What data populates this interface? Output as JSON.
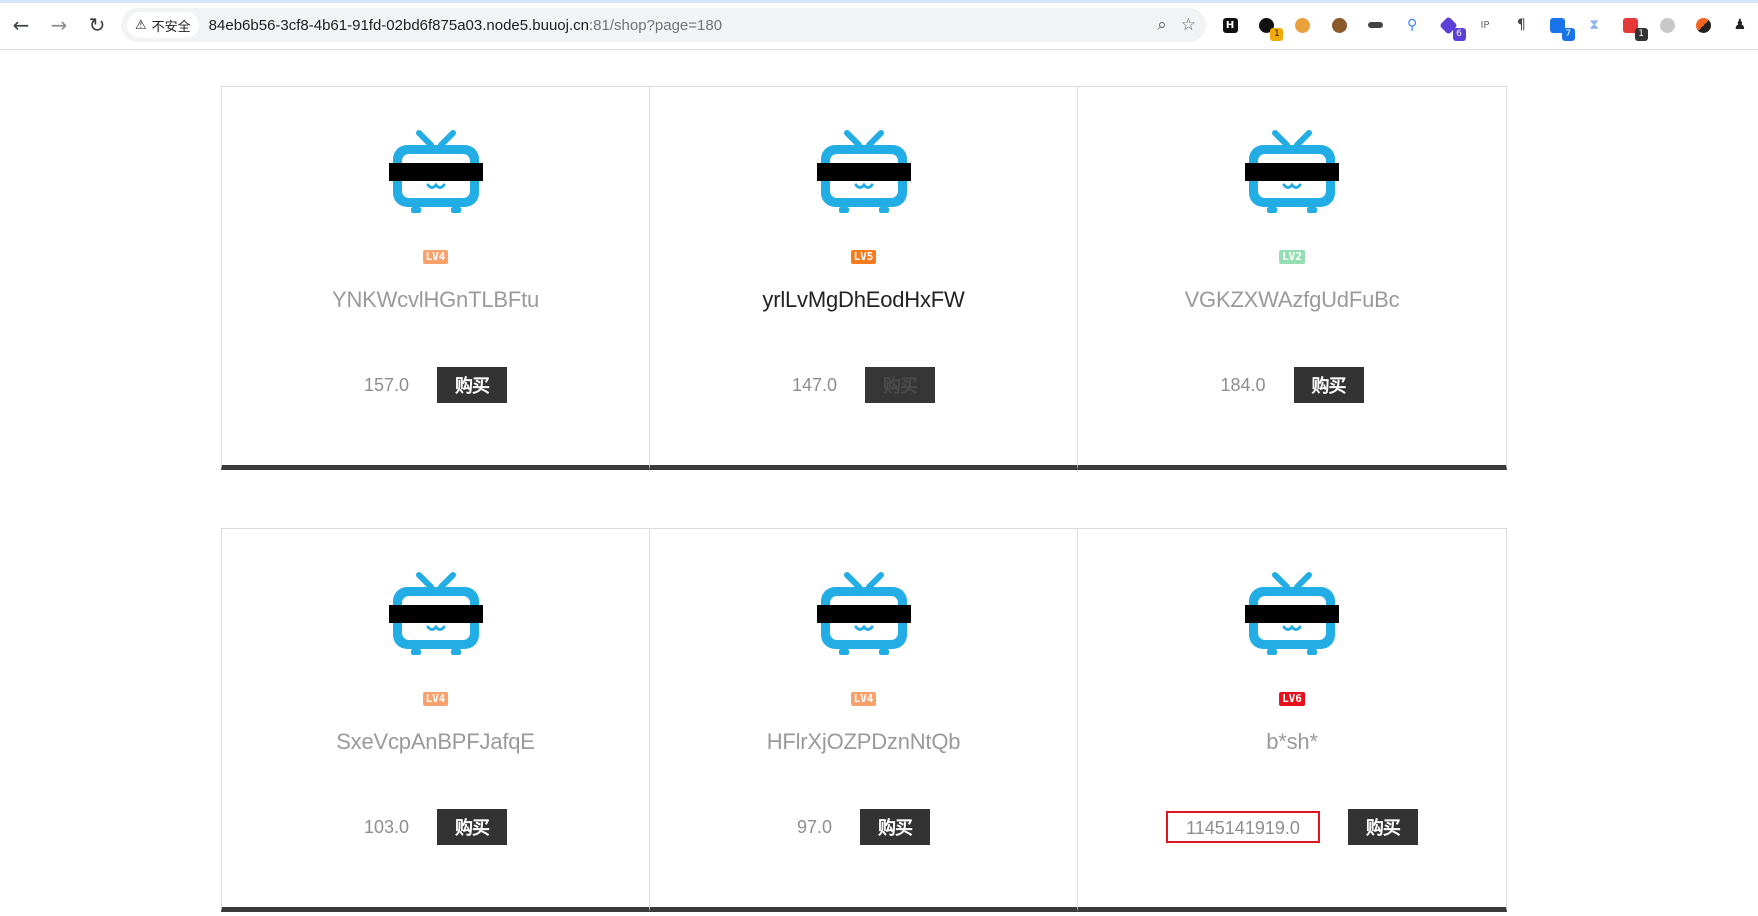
{
  "browser": {
    "security_label": "不安全",
    "url_host": "84eb6b56-3cf8-4b61-91fd-02bd6f875a03.node5.buuoj.cn",
    "url_rest": ":81/shop?page=180",
    "extension_badges": [
      "1",
      "6",
      "7",
      "1"
    ]
  },
  "products": [
    {
      "level": "LV4",
      "level_color": "#f9a16b",
      "name": "YNKWcvlHGnTLBFtu",
      "price": "157.0",
      "buy_label": "购买",
      "name_style": "muted",
      "button_enabled": true
    },
    {
      "level": "LV5",
      "level_color": "#f77a1d",
      "name": "yrlLvMgDhEodHxFW",
      "price": "147.0",
      "buy_label": "购买",
      "name_style": "dark",
      "button_enabled": false
    },
    {
      "level": "LV2",
      "level_color": "#95ddb2",
      "name": "VGKZXWAzfgUdFuBc",
      "price": "184.0",
      "buy_label": "购买",
      "name_style": "muted",
      "button_enabled": true
    },
    {
      "level": "LV4",
      "level_color": "#f9a16b",
      "name": "SxeVcpAnBPFJafqE",
      "price": "103.0",
      "buy_label": "购买",
      "name_style": "muted",
      "button_enabled": true
    },
    {
      "level": "LV4",
      "level_color": "#f9a16b",
      "name": "HFlrXjOZPDznNtQb",
      "price": "97.0",
      "buy_label": "购买",
      "name_style": "muted",
      "button_enabled": true
    },
    {
      "level": "LV6",
      "level_color": "#e80e1b",
      "name": "b*sh*",
      "price": "1145141919.0",
      "buy_label": "购买",
      "name_style": "muted",
      "button_enabled": true,
      "price_highlighted": true
    }
  ],
  "colors": {
    "tv_icon": "#23ade5",
    "censor_bar": "#000000",
    "button_bg": "#333333",
    "highlight_border": "#e0141e"
  }
}
